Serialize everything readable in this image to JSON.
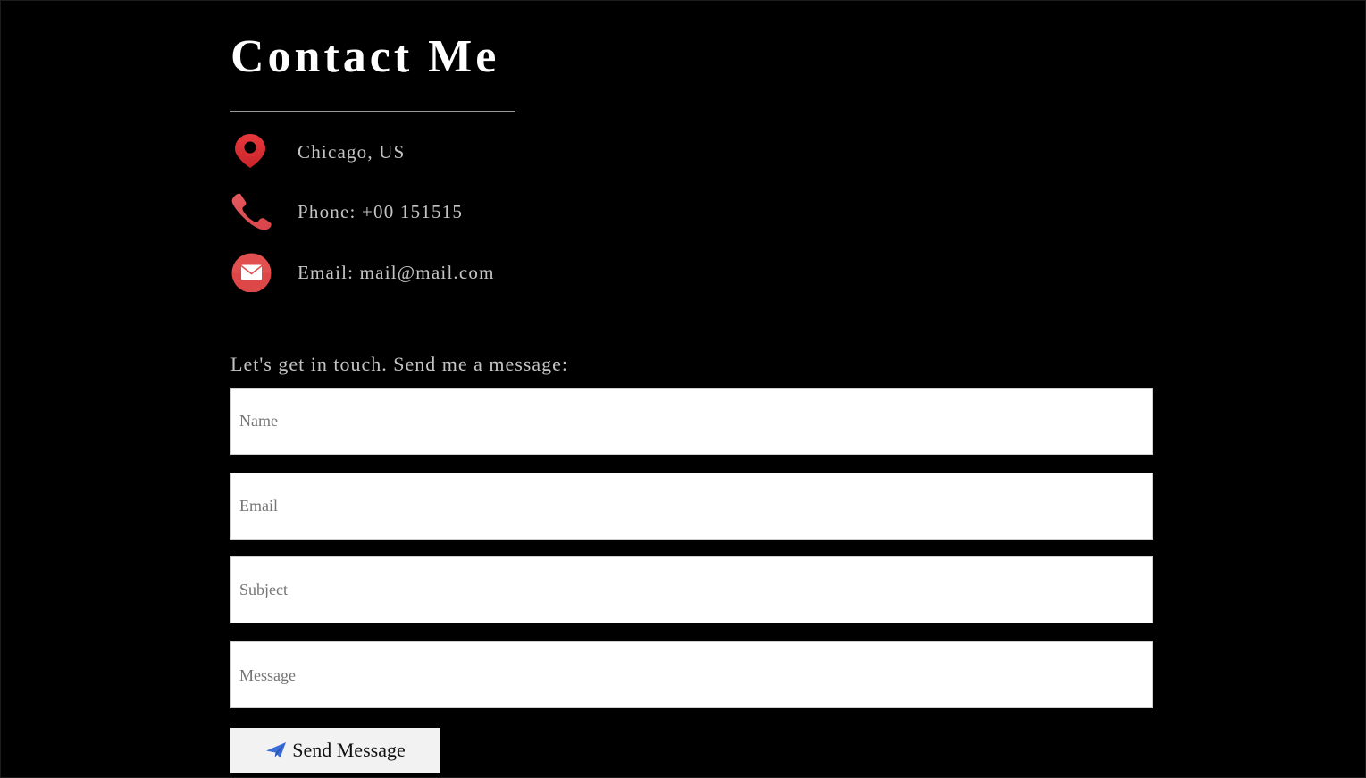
{
  "page": {
    "title": "Contact Me"
  },
  "contact_info": {
    "location": {
      "icon": "map-pin-icon",
      "text": "Chicago, US"
    },
    "phone": {
      "icon": "phone-icon",
      "text": "Phone: +00 151515"
    },
    "email": {
      "icon": "envelope-icon",
      "text": "Email: mail@mail.com"
    }
  },
  "form": {
    "prompt": "Let's get in touch. Send me a message:",
    "name_placeholder": "Name",
    "email_placeholder": "Email",
    "subject_placeholder": "Subject",
    "message_placeholder": "Message",
    "name_value": "",
    "email_value": "",
    "subject_value": "",
    "message_value": "",
    "submit": {
      "icon": "paper-plane-icon",
      "label": "Send Message"
    }
  },
  "colors": {
    "background": "#000000",
    "accent_red": "#e8383d",
    "icon_blue": "#3b6fd8",
    "muted_text": "#c4c4c4"
  }
}
